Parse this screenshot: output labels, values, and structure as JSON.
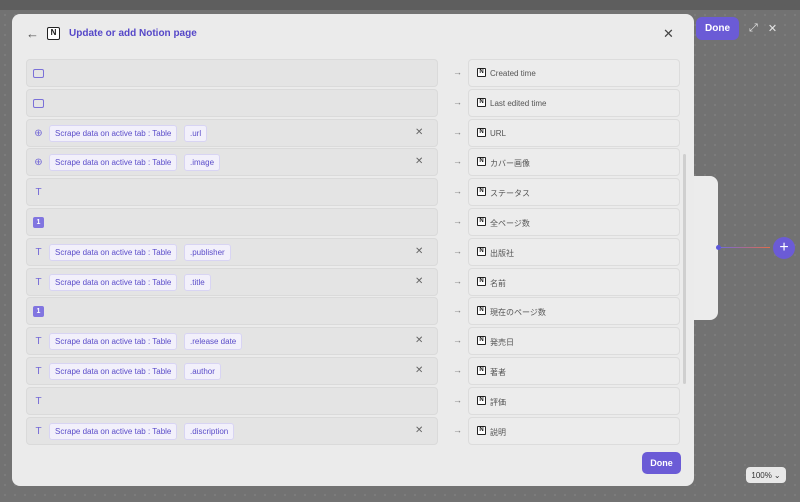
{
  "modal": {
    "title": "Update or add Notion page",
    "done_label": "Done",
    "mappings": [
      {
        "source_icon": "calendar-icon",
        "source_type": "date",
        "source": "",
        "field": "",
        "target": "Created time"
      },
      {
        "source_icon": "calendar-icon",
        "source_type": "date",
        "source": "",
        "field": "",
        "target": "Last edited time"
      },
      {
        "source_icon": "globe-icon",
        "source_type": "url",
        "source": "Scrape data on active tab : Table",
        "field": ".url",
        "target": "URL"
      },
      {
        "source_icon": "globe-icon",
        "source_type": "url",
        "source": "Scrape data on active tab : Table",
        "field": ".image",
        "target": "カバー画像"
      },
      {
        "source_icon": "text-icon",
        "source_type": "text",
        "source": "",
        "field": "",
        "target": "ステータス"
      },
      {
        "source_icon": "number-icon",
        "source_type": "number",
        "source": "",
        "field": "",
        "target": "全ページ数"
      },
      {
        "source_icon": "text-icon",
        "source_type": "text",
        "source": "Scrape data on active tab : Table",
        "field": ".publisher",
        "target": "出版社"
      },
      {
        "source_icon": "text-icon",
        "source_type": "text",
        "source": "Scrape data on active tab : Table",
        "field": ".title",
        "target": "名前"
      },
      {
        "source_icon": "number-icon",
        "source_type": "number",
        "source": "",
        "field": "",
        "target": "現在のページ数"
      },
      {
        "source_icon": "text-icon",
        "source_type": "text",
        "source": "Scrape data on active tab : Table",
        "field": ".release date",
        "target": "発売日"
      },
      {
        "source_icon": "text-icon",
        "source_type": "text",
        "source": "Scrape data on active tab : Table",
        "field": ".author",
        "target": "著者"
      },
      {
        "source_icon": "text-icon",
        "source_type": "text",
        "source": "",
        "field": "",
        "target": "評価"
      },
      {
        "source_icon": "text-icon",
        "source_type": "text",
        "source": "Scrape data on active tab : Table",
        "field": ".discription",
        "target": "説明"
      }
    ]
  },
  "toolbar": {
    "done_label": "Done"
  },
  "canvas": {
    "zoom_label": "100%"
  },
  "colors": {
    "accent": "#6b5bd6",
    "title": "#5547c8"
  }
}
